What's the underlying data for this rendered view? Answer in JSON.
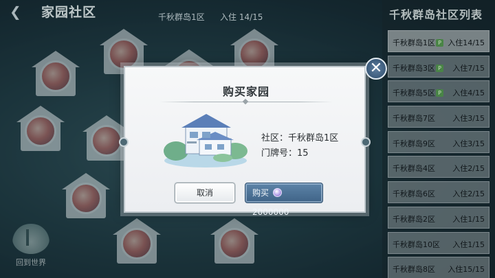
{
  "header": {
    "back_icon": "back-arrow-icon",
    "title": "家园社区",
    "island": "千秋群岛1区",
    "occupancy": "入住 14/15"
  },
  "map": {
    "houses": [
      {
        "id": "h1"
      },
      {
        "id": "h2"
      },
      {
        "id": "h3"
      },
      {
        "id": "h4"
      },
      {
        "id": "h5"
      },
      {
        "id": "h6"
      },
      {
        "id": "h7"
      },
      {
        "id": "h8"
      },
      {
        "id": "h9"
      },
      {
        "id": "h10"
      }
    ],
    "back_to_world": {
      "label": "回到世界",
      "icon": "island-palm-icon"
    }
  },
  "side_panel": {
    "title": "千秋群岛社区列表",
    "items": [
      {
        "name": "千秋群岛1区",
        "occupancy": "入住14/15",
        "tag": "P"
      },
      {
        "name": "千秋群岛3区",
        "occupancy": "入住7/15",
        "tag": "P"
      },
      {
        "name": "千秋群岛5区",
        "occupancy": "入住4/15",
        "tag": "P"
      },
      {
        "name": "千秋群岛7区",
        "occupancy": "入住3/15"
      },
      {
        "name": "千秋群岛9区",
        "occupancy": "入住3/15"
      },
      {
        "name": "千秋群岛4区",
        "occupancy": "入住2/15"
      },
      {
        "name": "千秋群岛6区",
        "occupancy": "入住2/15"
      },
      {
        "name": "千秋群岛2区",
        "occupancy": "入住1/15"
      },
      {
        "name": "千秋群岛10区",
        "occupancy": "入住1/15"
      },
      {
        "name": "千秋群岛8区",
        "occupancy": "入住15/15"
      }
    ]
  },
  "dialog": {
    "title": "购买家园",
    "community_label": "社区：千秋群岛1区",
    "door_label": "门牌号：15",
    "cancel_label": "取消",
    "buy_prefix": "购买",
    "price": "2000000",
    "currency_icon": "gem-coin-icon",
    "close_icon": "close-icon"
  },
  "colors": {
    "accent_blue": "#4a6f93",
    "tag_green": "#4f8f4a"
  }
}
